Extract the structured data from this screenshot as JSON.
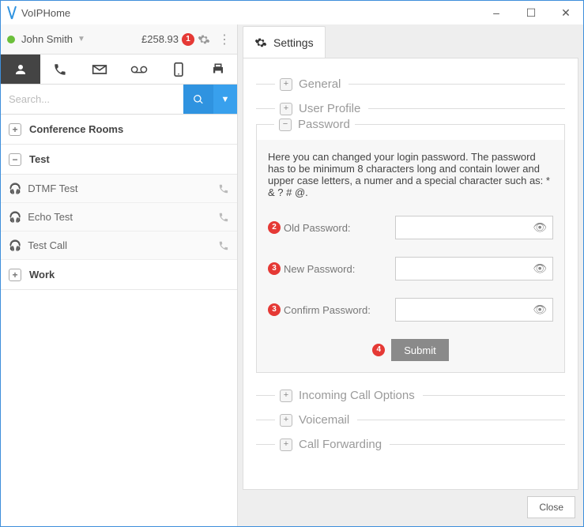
{
  "app": {
    "title": "VoIPHome"
  },
  "window_controls": {
    "min": "–",
    "max": "☐",
    "close": "✕"
  },
  "user": {
    "name": "John Smith",
    "balance": "£258.93",
    "badge": "1"
  },
  "search": {
    "placeholder": "Search..."
  },
  "groups": [
    {
      "label": "Conference Rooms",
      "expanded": false
    },
    {
      "label": "Test",
      "expanded": true,
      "items": [
        "DTMF Test",
        "Echo Test",
        "Test Call"
      ]
    },
    {
      "label": "Work",
      "expanded": false
    }
  ],
  "settings": {
    "tab_label": "Settings",
    "sections": {
      "general": "General",
      "user_profile": "User Profile",
      "password": "Password",
      "incoming": "Incoming Call Options",
      "voicemail": "Voicemail",
      "forwarding": "Call Forwarding"
    },
    "password": {
      "desc": "Here you can changed your login password. The password has to be minimum 8 characters long and contain lower and upper case letters, a numer and a special character such as: * & ? # @.",
      "fields": {
        "old": {
          "label": "Old Password:",
          "badge": "2",
          "value": ""
        },
        "new": {
          "label": "New Password:",
          "badge": "3",
          "value": ""
        },
        "confirm": {
          "label": "Confirm Password:",
          "badge": "3",
          "value": ""
        }
      },
      "submit_badge": "4",
      "submit_label": "Submit"
    }
  },
  "footer": {
    "close": "Close"
  }
}
